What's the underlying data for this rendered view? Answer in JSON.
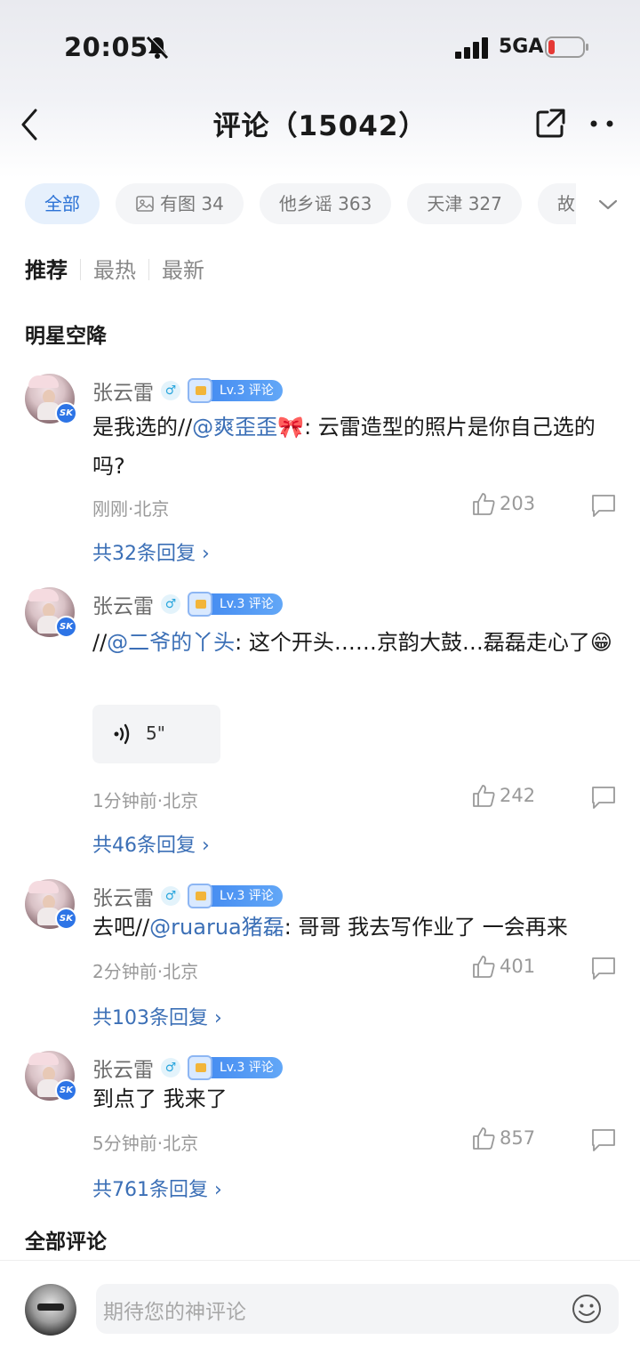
{
  "status_bar": {
    "time": "20:05",
    "network": "5GA"
  },
  "nav": {
    "title": "评论（15042）"
  },
  "filters": {
    "chips": [
      "全部",
      "有图 34",
      "他乡谣 363",
      "天津 327",
      "故"
    ]
  },
  "sort": {
    "tabs": [
      "推荐",
      "最热",
      "最新"
    ]
  },
  "sections": {
    "featured": "明星空降",
    "all": "全部评论"
  },
  "comments": [
    {
      "user": "张云雷",
      "level": "Lv.3 评论",
      "prefix": "是我选的//",
      "mention": "@爽歪歪🎀",
      "text": ": 云雷造型的照片是你自己选的吗?",
      "time": "刚刚·北京",
      "likes": "203",
      "replies": "共32条回复 ›"
    },
    {
      "user": "张云雷",
      "level": "Lv.3 评论",
      "prefix": "//",
      "mention": "@二爷的丫头",
      "text": ": 这个开头……京韵大鼓…磊磊走心了😁",
      "voice": "5\"",
      "time": "1分钟前·北京",
      "likes": "242",
      "replies": "共46条回复 ›"
    },
    {
      "user": "张云雷",
      "level": "Lv.3 评论",
      "prefix": "去吧//",
      "mention": "@ruarua猪磊",
      "text": ": 哥哥 我去写作业了 一会再来",
      "time": "2分钟前·北京",
      "likes": "401",
      "replies": "共103条回复 ›"
    },
    {
      "user": "张云雷",
      "level": "Lv.3 评论",
      "prefix": "",
      "mention": "",
      "text": "到点了 我来了",
      "time": "5分钟前·北京",
      "likes": "857",
      "replies": "共761条回复 ›"
    }
  ],
  "input": {
    "placeholder": "期待您的神评论"
  },
  "icons": [
    "back-icon",
    "share-icon",
    "more-icon",
    "image-icon",
    "chevron-down-icon",
    "thumb-up-icon",
    "comment-icon",
    "voice-icon",
    "emoji-icon",
    "bell-muted-icon",
    "signal-icon",
    "battery-icon"
  ],
  "colors": {
    "accent": "#2d73d6",
    "mention": "#3b6fb6",
    "level_badge": "#3f86f0",
    "battery_low": "#e53935"
  }
}
